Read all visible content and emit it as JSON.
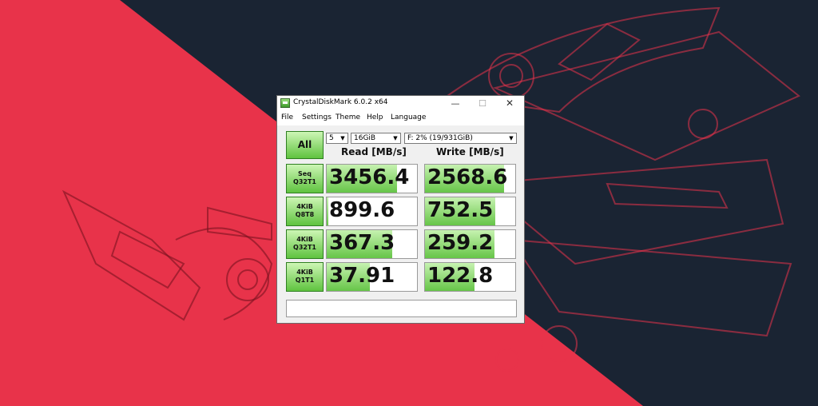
{
  "window": {
    "title": "CrystalDiskMark 6.0.2 x64",
    "minimize": "—",
    "maximize": "☐",
    "close": "✕"
  },
  "menu": [
    "File",
    "Settings",
    "Theme",
    "Help",
    "Language"
  ],
  "controls": {
    "all_label": "All",
    "count": "5",
    "size": "16GiB",
    "drive": "F: 2% (19/931GiB)",
    "dropdown_arrow": "▼"
  },
  "headers": {
    "read": "Read [MB/s]",
    "write": "Write [MB/s]"
  },
  "tests": [
    {
      "line1": "Seq",
      "line2": "Q32T1",
      "read": "3456.4",
      "write": "2568.6",
      "read_fill": 0.78,
      "write_fill": 0.88
    },
    {
      "line1": "4KiB",
      "line2": "Q8T8",
      "read": "899.6",
      "write": "752.5",
      "read_fill": 0.02,
      "write_fill": 0.78
    },
    {
      "line1": "4KiB",
      "line2": "Q32T1",
      "read": "367.3",
      "write": "259.2",
      "read_fill": 0.73,
      "write_fill": 0.77
    },
    {
      "line1": "4KiB",
      "line2": "Q1T1",
      "read": "37.91",
      "write": "122.8",
      "read_fill": 0.48,
      "write_fill": 0.55
    }
  ],
  "comment": "",
  "colors": {
    "accent": "#5fc33f",
    "background_red": "#e8334a",
    "background_dark": "#1a2433"
  }
}
